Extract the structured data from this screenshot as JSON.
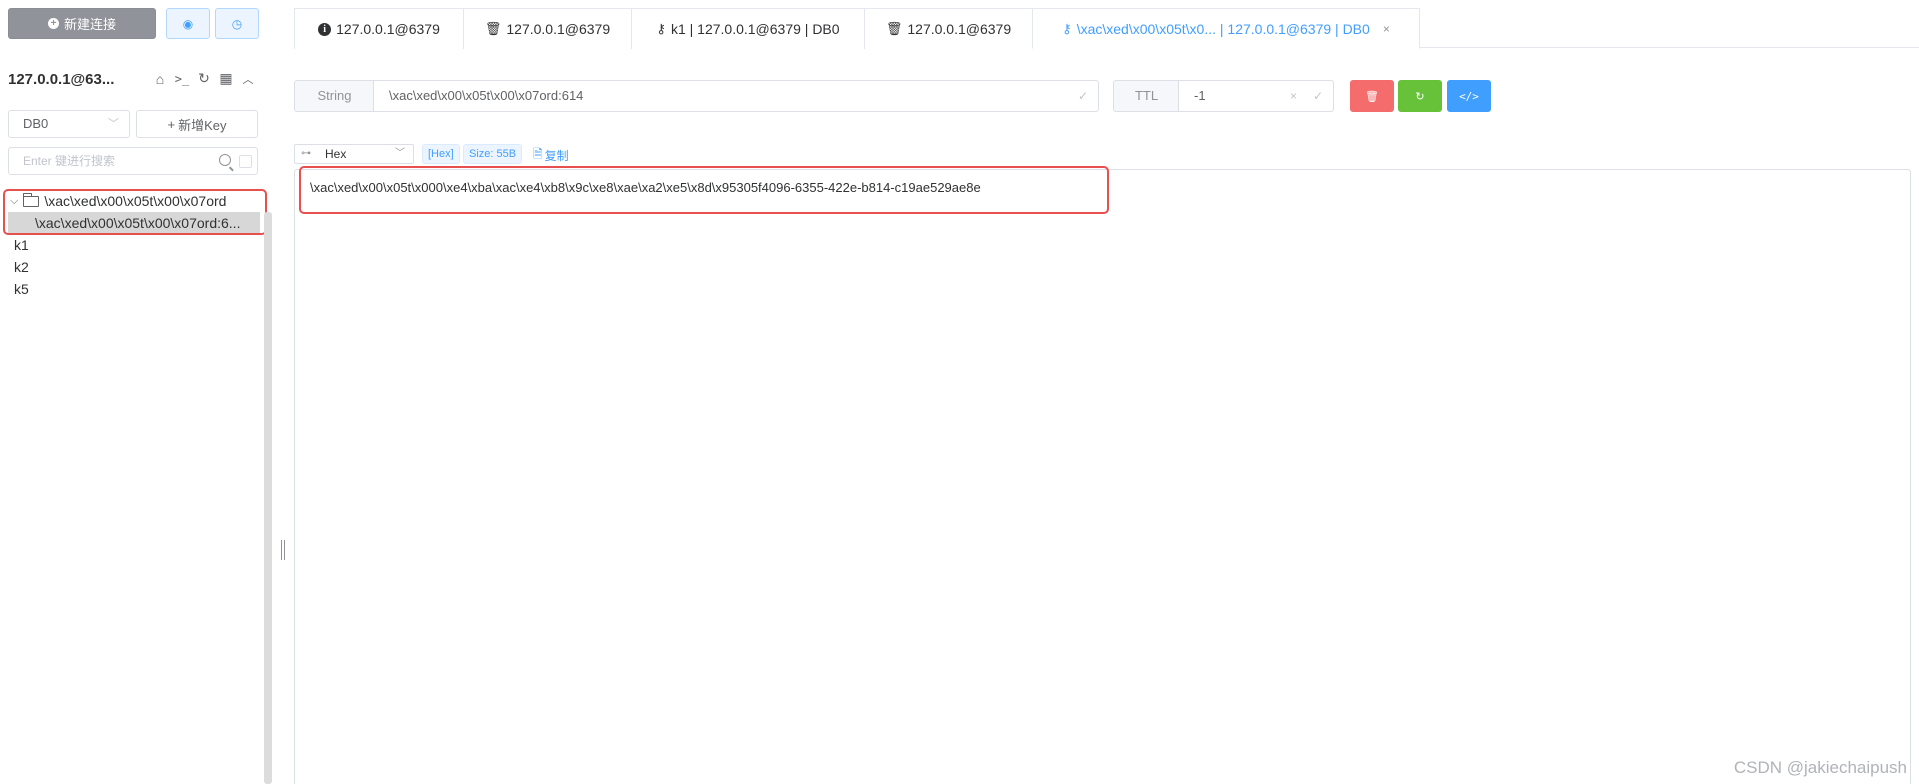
{
  "sidebar": {
    "new_connection_label": "新建连接",
    "connection_title": "127.0.0.1@63...",
    "db_select_value": "DB0",
    "new_key_label": "新增Key",
    "search_placeholder": "Enter 键进行搜索",
    "tree": {
      "folder_label": "\\xac\\xed\\x00\\x05t\\x00\\x07ord",
      "selected_child_label": "\\xac\\xed\\x00\\x05t\\x00\\x07ord:6...",
      "keys": [
        "k1",
        "k2",
        "k5"
      ]
    }
  },
  "tabs": [
    {
      "label": "127.0.0.1@6379",
      "icon": "info-icon"
    },
    {
      "label": "127.0.0.1@6379",
      "icon": "trash-icon"
    },
    {
      "label": "k1 | 127.0.0.1@6379 | DB0",
      "icon": "key-icon"
    },
    {
      "label": "127.0.0.1@6379",
      "icon": "trash-icon"
    },
    {
      "label": "\\xac\\xed\\x00\\x05t\\x0... | 127.0.0.1@6379 | DB0",
      "icon": "key-icon",
      "active": true
    }
  ],
  "key_toolbar": {
    "type_label": "String",
    "key_name": "\\xac\\xed\\x00\\x05t\\x00\\x07ord:614",
    "ttl_label": "TTL",
    "ttl_value": "-1"
  },
  "format_bar": {
    "format_value": "Hex",
    "format_tag": "[Hex]",
    "size_tag": "Size: 55B",
    "copy_label": "复制"
  },
  "value": {
    "text": "\\xac\\xed\\x00\\x05t\\x000\\xe4\\xba\\xac\\xe4\\xb8\\x9c\\xe8\\xae\\xa2\\xe5\\x8d\\x95305f4096-6355-422e-b814-c19ae529ae8e"
  },
  "watermark": "CSDN @jakiechaipush",
  "colors": {
    "primary": "#409eff",
    "danger": "#f56c6c",
    "success": "#67c23a",
    "highlight_box": "#e8504f"
  }
}
